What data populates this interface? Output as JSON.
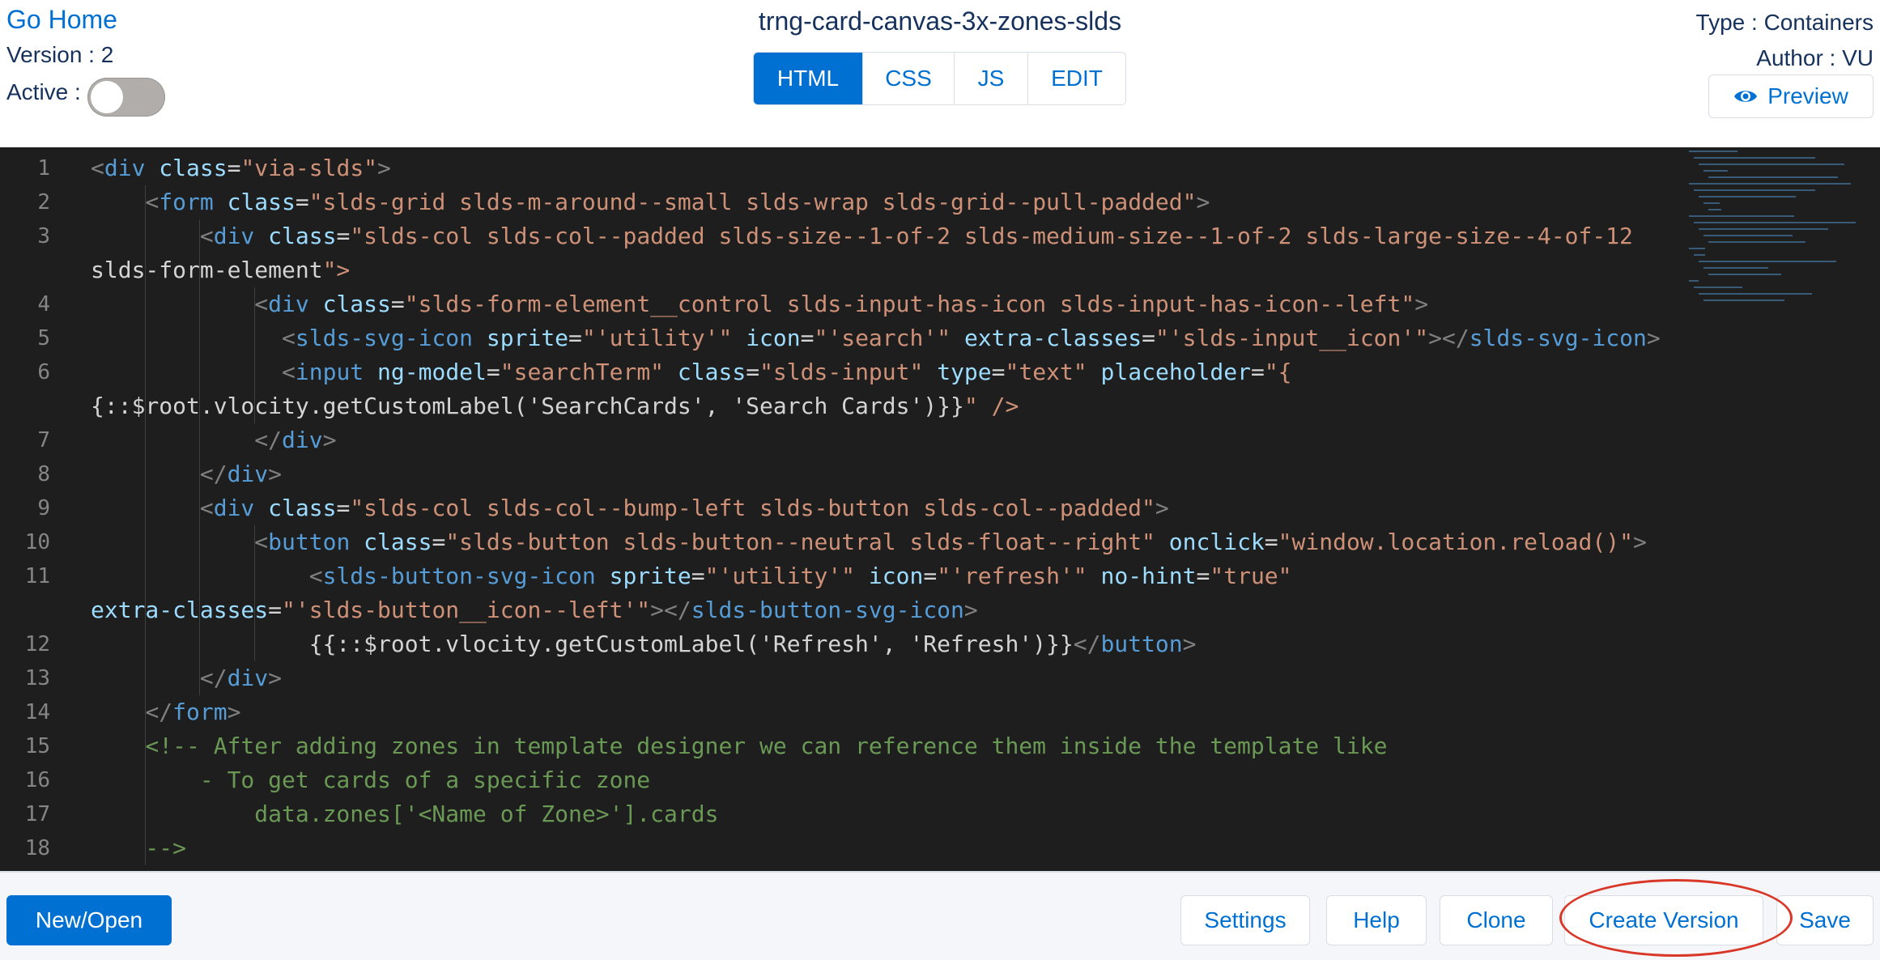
{
  "header": {
    "go_home": "Go Home",
    "version": "Version : 2",
    "active_label": "Active :",
    "active_on": false,
    "title": "trng-card-canvas-3x-zones-slds",
    "tabs": [
      "HTML",
      "CSS",
      "JS",
      "EDIT"
    ],
    "active_tab": "HTML",
    "type": "Type : Containers",
    "author": "Author : VU",
    "preview_label": "Preview",
    "preview_icon": "eye-icon"
  },
  "editor": {
    "line_numbers": [
      "1",
      "2",
      "3",
      "4",
      "5",
      "6",
      "7",
      "8",
      "9",
      "10",
      "11",
      "12",
      "13",
      "14",
      "15",
      "16",
      "17",
      "18"
    ],
    "lines": [
      "<div class=\"via-slds\">",
      "    <form class=\"slds-grid slds-m-around--small slds-wrap slds-grid--pull-padded\">",
      "        <div class=\"slds-col slds-col--padded slds-size--1-of-2 slds-medium-size--1-of-2 slds-large-size--4-of-12",
      "slds-form-element\">",
      "            <div class=\"slds-form-element__control slds-input-has-icon slds-input-has-icon--left\">",
      "              <slds-svg-icon sprite=\"'utility'\" icon=\"'search'\" extra-classes=\"'slds-input__icon'\"></slds-svg-icon>",
      "              <input ng-model=\"searchTerm\" class=\"slds-input\" type=\"text\" placeholder=\"{",
      "{::$root.vlocity.getCustomLabel('SearchCards', 'Search Cards')}}\" />",
      "            </div>",
      "        </div>",
      "        <div class=\"slds-col slds-col--bump-left slds-button slds-col--padded\">",
      "            <button class=\"slds-button slds-button--neutral slds-float--right\" onclick=\"window.location.reload()\">",
      "                <slds-button-svg-icon sprite=\"'utility'\" icon=\"'refresh'\" no-hint=\"true\"",
      "extra-classes=\"'slds-button__icon--left'\"></slds-button-svg-icon>",
      "                {{::$root.vlocity.getCustomLabel('Refresh', 'Refresh')}}</button>",
      "        </div>",
      "    </form>",
      "    <!-- After adding zones in template designer we can reference them inside the template like",
      "        - To get cards of a specific zone",
      "            data.zones['<Name of Zone>'].cards",
      "    -->"
    ]
  },
  "footer": {
    "new_open": "New/Open",
    "settings": "Settings",
    "help": "Help",
    "clone": "Clone",
    "create_version": "Create Version",
    "save": "Save"
  },
  "colors": {
    "brand": "#0070d2",
    "highlight": "#d93829",
    "editor_bg": "#1e1e1e"
  }
}
